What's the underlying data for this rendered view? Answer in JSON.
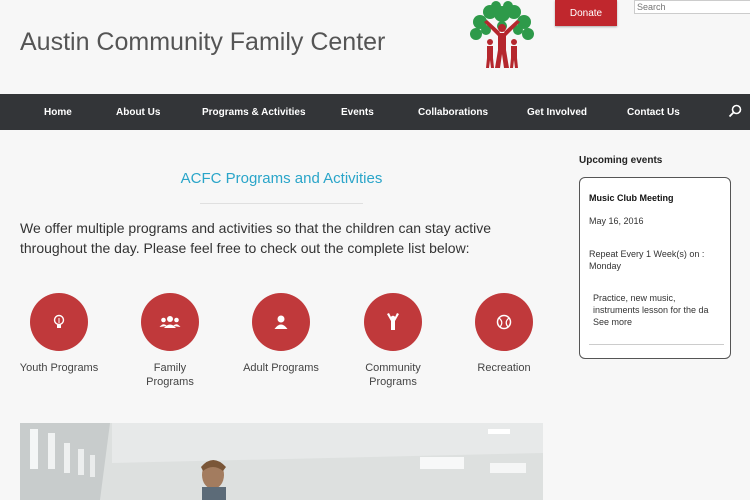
{
  "header": {
    "site_title": "Austin Community Family Center",
    "donate_label": "Donate",
    "search_placeholder": "Search"
  },
  "nav": {
    "items": [
      "Home",
      "About Us",
      "Programs & Activities",
      "Events",
      "Collaborations",
      "Get Involved",
      "Contact Us"
    ]
  },
  "main": {
    "heading": "ACFC Programs and Activities",
    "intro": "We offer multiple programs and activities so that the children can stay active throughout the day. Please feel free to check out the complete list below:",
    "programs": [
      {
        "line1": "Youth Programs",
        "line2": "",
        "icon": "lightbulb-icon"
      },
      {
        "line1": "Family",
        "line2": "Programs",
        "icon": "group-icon"
      },
      {
        "line1": "Adult Programs",
        "line2": "",
        "icon": "person-icon"
      },
      {
        "line1": "Community",
        "line2": "Programs",
        "icon": "cheering-person-icon"
      },
      {
        "line1": "Recreation",
        "line2": "",
        "icon": "ball-icon"
      }
    ]
  },
  "sidebar": {
    "title": "Upcoming events",
    "event": {
      "title": "Music Club Meeting",
      "date": "May 16, 2016",
      "repeat": "Repeat Every 1 Week(s) on : Monday",
      "desc_line1": "Practice, new music,",
      "desc_line2": "instruments lesson for the da",
      "see_more": "See more"
    }
  },
  "colors": {
    "brand_red": "#c0272d",
    "accent_blue": "#2aa5c9",
    "nav_bg": "#333538"
  }
}
